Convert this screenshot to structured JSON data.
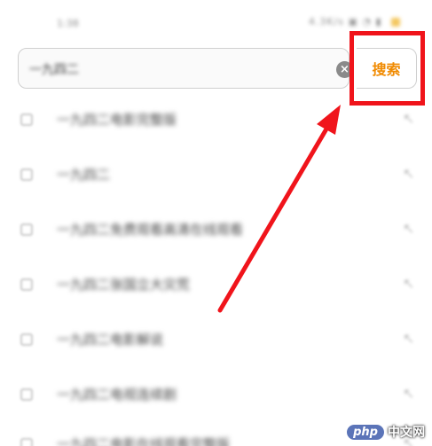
{
  "status_bar": {
    "time": "1:38",
    "indicators": "4.3K/s ▣ ◔ ▮"
  },
  "search": {
    "query": "一九四二",
    "clear_icon": "clear-icon",
    "button_label": "搜索",
    "button_color": "#f08a00"
  },
  "highlight": {
    "color": "#f0141b"
  },
  "suggestions": [
    {
      "text": "一九四二电影完整版",
      "arrow": "↖"
    },
    {
      "text": "一九四二",
      "arrow": "↖"
    },
    {
      "text": "一九四二免费观看高清在线观看",
      "arrow": "↖"
    },
    {
      "text": "一九四二张国立大灾荒",
      "arrow": "↖"
    },
    {
      "text": "一九四二电影解说",
      "arrow": "↖"
    },
    {
      "text": "一九四二电视连续剧",
      "arrow": "↖"
    },
    {
      "text": "一九四二电影在线观看完整版",
      "arrow": "↖"
    }
  ],
  "watermark": {
    "badge": "php",
    "text": "中文网"
  }
}
